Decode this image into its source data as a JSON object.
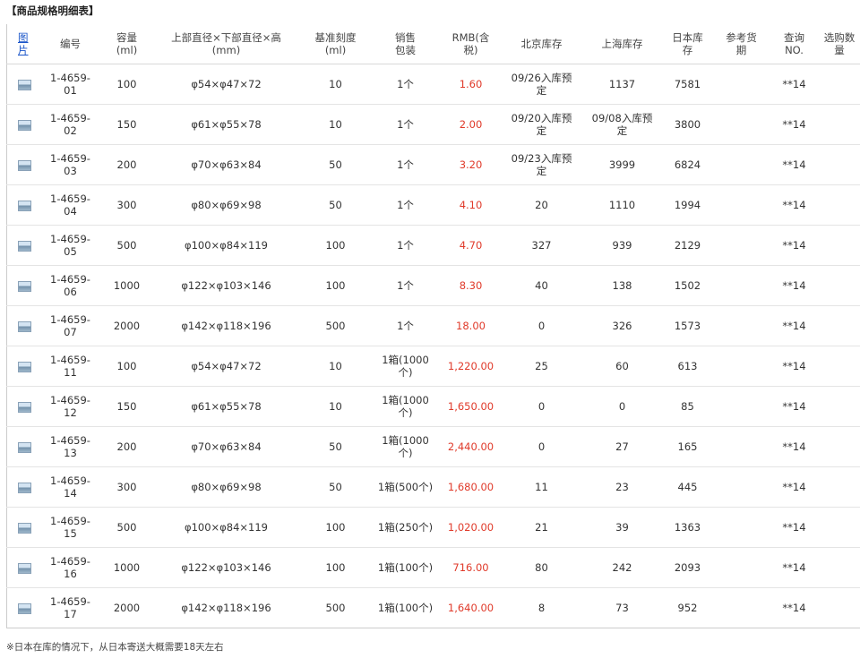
{
  "section_title": "【商品规格明细表】",
  "columns": {
    "photo": "图\n片",
    "code": "编号",
    "capacity": "容量\n(ml)",
    "dimensions": "上部直径×下部直径×高\n(mm)",
    "graduation": "基准刻度\n(ml)",
    "package": "销售\n包装",
    "price": "RMB(含\n税)",
    "beijing_stock": "北京库存",
    "shanghai_stock": "上海库存",
    "japan_stock": "日本库\n存",
    "lead_time": "参考货\n期",
    "inquiry": "查询\nNO.",
    "quantity": "选购数\n量"
  },
  "rows": [
    {
      "code": "1-4659-\n01",
      "capacity": "100",
      "dimensions": "φ54×φ47×72",
      "graduation": "10",
      "package": "1个",
      "price": "1.60",
      "beijing": "09/26入库预\n定",
      "shanghai": "1137",
      "japan": "7581",
      "lead_time": "",
      "inquiry": "**14",
      "quantity": ""
    },
    {
      "code": "1-4659-\n02",
      "capacity": "150",
      "dimensions": "φ61×φ55×78",
      "graduation": "10",
      "package": "1个",
      "price": "2.00",
      "beijing": "09/20入库预\n定",
      "shanghai": "09/08入库预\n定",
      "japan": "3800",
      "lead_time": "",
      "inquiry": "**14",
      "quantity": ""
    },
    {
      "code": "1-4659-\n03",
      "capacity": "200",
      "dimensions": "φ70×φ63×84",
      "graduation": "50",
      "package": "1个",
      "price": "3.20",
      "beijing": "09/23入库预\n定",
      "shanghai": "3999",
      "japan": "6824",
      "lead_time": "",
      "inquiry": "**14",
      "quantity": ""
    },
    {
      "code": "1-4659-\n04",
      "capacity": "300",
      "dimensions": "φ80×φ69×98",
      "graduation": "50",
      "package": "1个",
      "price": "4.10",
      "beijing": "20",
      "shanghai": "1110",
      "japan": "1994",
      "lead_time": "",
      "inquiry": "**14",
      "quantity": ""
    },
    {
      "code": "1-4659-\n05",
      "capacity": "500",
      "dimensions": "φ100×φ84×119",
      "graduation": "100",
      "package": "1个",
      "price": "4.70",
      "beijing": "327",
      "shanghai": "939",
      "japan": "2129",
      "lead_time": "",
      "inquiry": "**14",
      "quantity": ""
    },
    {
      "code": "1-4659-\n06",
      "capacity": "1000",
      "dimensions": "φ122×φ103×146",
      "graduation": "100",
      "package": "1个",
      "price": "8.30",
      "beijing": "40",
      "shanghai": "138",
      "japan": "1502",
      "lead_time": "",
      "inquiry": "**14",
      "quantity": ""
    },
    {
      "code": "1-4659-\n07",
      "capacity": "2000",
      "dimensions": "φ142×φ118×196",
      "graduation": "500",
      "package": "1个",
      "price": "18.00",
      "beijing": "0",
      "shanghai": "326",
      "japan": "1573",
      "lead_time": "",
      "inquiry": "**14",
      "quantity": ""
    },
    {
      "code": "1-4659-\n11",
      "capacity": "100",
      "dimensions": "φ54×φ47×72",
      "graduation": "10",
      "package": "1箱(1000\n个)",
      "price": "1,220.00",
      "beijing": "25",
      "shanghai": "60",
      "japan": "613",
      "lead_time": "",
      "inquiry": "**14",
      "quantity": ""
    },
    {
      "code": "1-4659-\n12",
      "capacity": "150",
      "dimensions": "φ61×φ55×78",
      "graduation": "10",
      "package": "1箱(1000\n个)",
      "price": "1,650.00",
      "beijing": "0",
      "shanghai": "0",
      "japan": "85",
      "lead_time": "",
      "inquiry": "**14",
      "quantity": ""
    },
    {
      "code": "1-4659-\n13",
      "capacity": "200",
      "dimensions": "φ70×φ63×84",
      "graduation": "50",
      "package": "1箱(1000\n个)",
      "price": "2,440.00",
      "beijing": "0",
      "shanghai": "27",
      "japan": "165",
      "lead_time": "",
      "inquiry": "**14",
      "quantity": ""
    },
    {
      "code": "1-4659-\n14",
      "capacity": "300",
      "dimensions": "φ80×φ69×98",
      "graduation": "50",
      "package": "1箱(500个)",
      "price": "1,680.00",
      "beijing": "11",
      "shanghai": "23",
      "japan": "445",
      "lead_time": "",
      "inquiry": "**14",
      "quantity": ""
    },
    {
      "code": "1-4659-\n15",
      "capacity": "500",
      "dimensions": "φ100×φ84×119",
      "graduation": "100",
      "package": "1箱(250个)",
      "price": "1,020.00",
      "beijing": "21",
      "shanghai": "39",
      "japan": "1363",
      "lead_time": "",
      "inquiry": "**14",
      "quantity": ""
    },
    {
      "code": "1-4659-\n16",
      "capacity": "1000",
      "dimensions": "φ122×φ103×146",
      "graduation": "100",
      "package": "1箱(100个)",
      "price": "716.00",
      "beijing": "80",
      "shanghai": "242",
      "japan": "2093",
      "lead_time": "",
      "inquiry": "**14",
      "quantity": ""
    },
    {
      "code": "1-4659-\n17",
      "capacity": "2000",
      "dimensions": "φ142×φ118×196",
      "graduation": "500",
      "package": "1箱(100个)",
      "price": "1,640.00",
      "beijing": "8",
      "shanghai": "73",
      "japan": "952",
      "lead_time": "",
      "inquiry": "**14",
      "quantity": ""
    }
  ],
  "footnote": "※日本在库的情况下，从日本寄送大概需要18天左右",
  "colors": {
    "price": "#e03a2a",
    "link": "#1a55c9",
    "border": "#e4e4e4"
  },
  "icons": {
    "thumbnail": "image-thumbnail-icon"
  }
}
